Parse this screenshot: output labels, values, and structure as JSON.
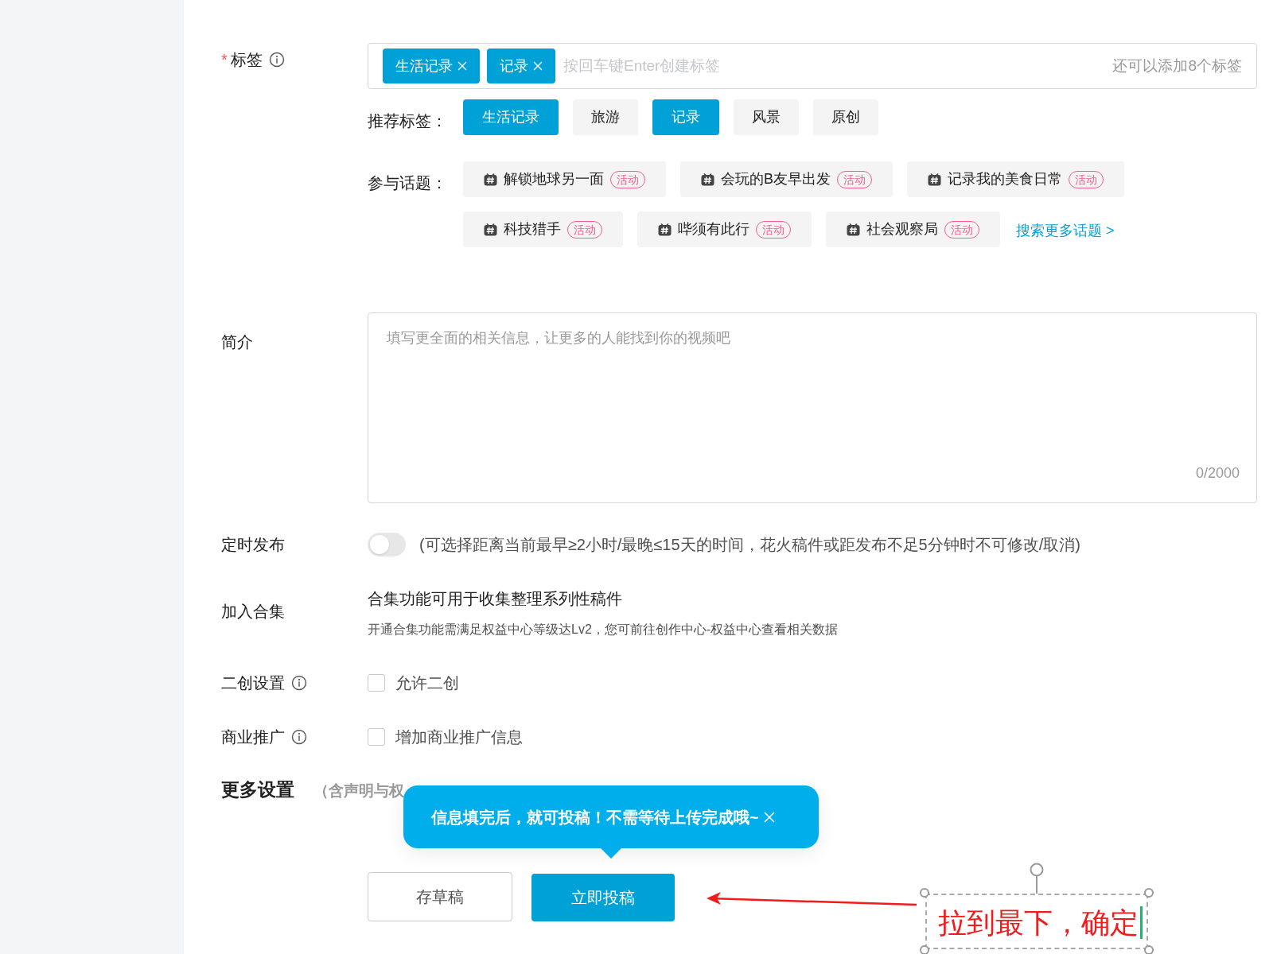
{
  "tags": {
    "label": "标签",
    "required_mark": "*",
    "items": [
      {
        "text": "生活记录"
      },
      {
        "text": "记录"
      }
    ],
    "placeholder": "按回车键Enter创建标签",
    "remaining": "还可以添加8个标签"
  },
  "recommended": {
    "label": "推荐标签：",
    "items": [
      {
        "text": "生活记录",
        "selected": true
      },
      {
        "text": "旅游",
        "selected": false
      },
      {
        "text": "记录",
        "selected": true
      },
      {
        "text": "风景",
        "selected": false
      },
      {
        "text": "原创",
        "selected": false
      }
    ]
  },
  "topics": {
    "label": "参与话题：",
    "rows": [
      [
        {
          "text": "解锁地球另一面",
          "badge": "活动"
        },
        {
          "text": "会玩的B友早出发",
          "badge": "活动"
        },
        {
          "text": "记录我的美食日常",
          "badge": "活动"
        }
      ],
      [
        {
          "text": "科技猎手",
          "badge": "活动"
        },
        {
          "text": "哔须有此行",
          "badge": "活动"
        },
        {
          "text": "社会观察局",
          "badge": "活动"
        }
      ]
    ],
    "more_link": "搜索更多话题 >"
  },
  "description": {
    "label": "简介",
    "placeholder": "填写更全面的相关信息，让更多的人能找到你的视频吧",
    "counter": "0/2000"
  },
  "schedule": {
    "label": "定时发布",
    "on": false,
    "hint": "(可选择距离当前最早≥2小时/最晚≤15天的时间，花火稿件或距发布不足5分钟时不可修改/取消)"
  },
  "collection": {
    "label": "加入合集",
    "title": "合集功能可用于收集整理系列性稿件",
    "note": "开通合集功能需满足权益中心等级达Lv2，您可前往创作中心-权益中心查看相关数据"
  },
  "options": [
    {
      "label": "二创设置",
      "checkbox_label": "允许二创",
      "checked": false
    },
    {
      "label": "商业推广",
      "checkbox_label": "增加商业推广信息",
      "checked": false
    }
  ],
  "more_settings": {
    "title": "更多设置",
    "subtitle": "（含声明与权"
  },
  "tooltip": {
    "text": "信息填完后，就可投稿！不需等待上传完成哦~"
  },
  "buttons": [
    {
      "label": "存草稿",
      "kind": "secondary"
    },
    {
      "label": "立即投稿",
      "kind": "primary"
    }
  ],
  "annotation": {
    "text": "拉到最下，确定"
  }
}
